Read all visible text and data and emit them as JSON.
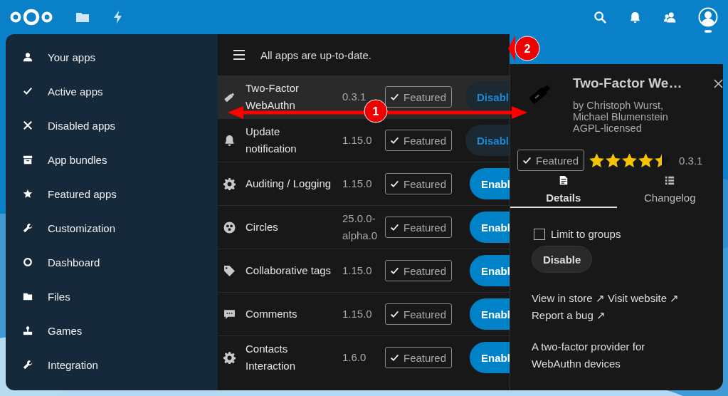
{
  "navigation": {
    "items": [
      {
        "label": "Your apps",
        "kind": "user",
        "selected": false
      },
      {
        "label": "Active apps",
        "kind": "check",
        "selected": false
      },
      {
        "label": "Disabled apps",
        "kind": "cross",
        "selected": false
      },
      {
        "label": "App bundles",
        "kind": "archive",
        "selected": false
      },
      {
        "label": "Featured apps",
        "kind": "star",
        "selected": false
      },
      {
        "label": "Customization",
        "kind": "wrench",
        "selected": false
      },
      {
        "label": "Dashboard",
        "kind": "ring",
        "selected": false
      },
      {
        "label": "Files",
        "kind": "folder",
        "selected": false
      },
      {
        "label": "Games",
        "kind": "joystick",
        "selected": false
      },
      {
        "label": "Integration",
        "kind": "wrench",
        "selected": false
      }
    ]
  },
  "app_list": {
    "message": "All apps are up-to-date.",
    "rows": [
      {
        "name": "Two-Factor WebAuthn",
        "version": "0.3.1",
        "badge": "Featured",
        "action": "Disabl",
        "enabled": true,
        "selected": true,
        "kind": "usb"
      },
      {
        "name": "Update notification",
        "version": "1.15.0",
        "badge": "Featured",
        "action": "Disabl",
        "enabled": true,
        "selected": false,
        "kind": "bell"
      },
      {
        "name": "Auditing / Logging",
        "version": "1.15.0",
        "badge": "Featured",
        "action": "Enabl",
        "enabled": false,
        "selected": false,
        "kind": "gear"
      },
      {
        "name": "Circles",
        "version": "25.0.0-alpha.0",
        "badge": "Featured",
        "action": "Enabl",
        "enabled": false,
        "selected": false,
        "kind": "circles"
      },
      {
        "name": "Collaborative tags",
        "version": "1.15.0",
        "badge": "Featured",
        "action": "Enabl",
        "enabled": false,
        "selected": false,
        "kind": "tag"
      },
      {
        "name": "Comments",
        "version": "1.15.0",
        "badge": "Featured",
        "action": "Enabl",
        "enabled": false,
        "selected": false,
        "kind": "comment"
      },
      {
        "name": "Contacts Interaction",
        "version": "1.6.0",
        "badge": "Featured",
        "action": "Enabl",
        "enabled": false,
        "selected": false,
        "kind": "gear"
      }
    ]
  },
  "details": {
    "title": "Two-Factor We…",
    "authors": "by Christoph Wurst, Michael Blumenstein",
    "license": "AGPL-licensed",
    "badge": "Featured",
    "stars": 4.5,
    "version": "0.3.1",
    "tabs": [
      {
        "label": "Details",
        "kind": "document",
        "selected": true
      },
      {
        "label": "Changelog",
        "kind": "list",
        "selected": false
      }
    ],
    "limit_to_groups": {
      "label": "Limit to groups",
      "checked": false
    },
    "action_button": "Disable",
    "links": [
      {
        "label": "View in store ↗"
      },
      {
        "label": "Visit website ↗"
      },
      {
        "label": "Report a bug ↗"
      }
    ],
    "description": "A two-factor provider for WebAuthn devices"
  },
  "annotations": [
    {
      "label": "1",
      "kind": "double-arrow"
    },
    {
      "label": "2",
      "kind": "pointer"
    }
  ]
}
